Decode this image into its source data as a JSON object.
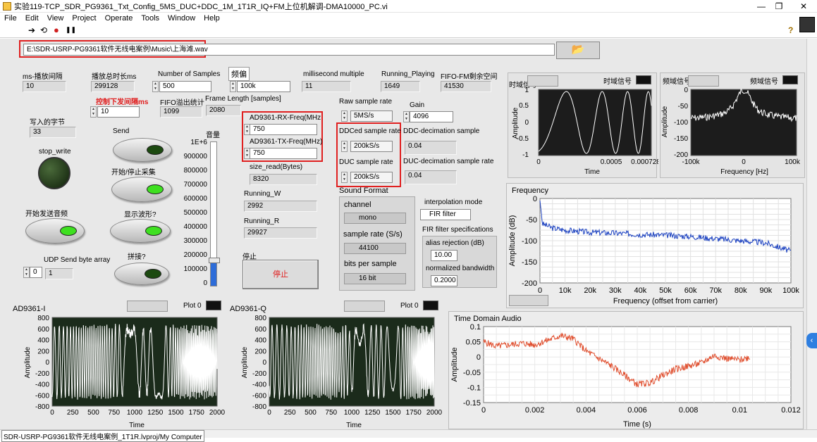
{
  "window": {
    "title": "实验119-TCP_SDR_PG9361_Txt_Config_5MS_DUC+DDC_1M_1T1R_IQ+FM上位机解调-DMA10000_PC.vi"
  },
  "menu": [
    "File",
    "Edit",
    "View",
    "Project",
    "Operate",
    "Tools",
    "Window",
    "Help"
  ],
  "toolbar": {
    "run": "➔",
    "run_cont": "⟲",
    "abort": "●",
    "pause": "❚❚",
    "help": "?"
  },
  "file_path": {
    "value": "E:\\SDR-USRP-PG9361软件无线电案例\\Music\\上海滩.wav"
  },
  "controls": {
    "ms_interval": {
      "label": "ms-播放间隔",
      "value": "10"
    },
    "play_total": {
      "label": "播放总时长ms",
      "value": "299128"
    },
    "num_samples": {
      "label": "Number of Samples",
      "value": "500"
    },
    "freq_offset": {
      "label": "频偏",
      "value": "100k"
    },
    "ms_multiple": {
      "label": "millisecond multiple",
      "value": "11"
    },
    "running_playing": {
      "label": "Running_Playing",
      "value": "1649"
    },
    "fifo_fm": {
      "label": "FIFO-FM剩余空间",
      "value": "41530"
    },
    "ctrl_interval": {
      "label": "控制下发间隔ms",
      "value": "10"
    },
    "fifo_overflow": {
      "label": "FIFO溢出统计",
      "value": "1099"
    },
    "frame_length": {
      "label": "Frame Length [samples]",
      "value": "2080"
    },
    "bytes_written": {
      "label": "写入的字节",
      "value": "33"
    },
    "send": {
      "label": "Send"
    },
    "stop_write": {
      "label": "stop_write"
    },
    "start_stop": {
      "label": "开始/停止采集"
    },
    "start_audio": {
      "label": "开始发送音频"
    },
    "show_wave": {
      "label": "显示波形?"
    },
    "splice": {
      "label": "拼接?"
    },
    "udp_send": {
      "label": "UDP Send byte array",
      "index": "0",
      "value": "1"
    },
    "volume": {
      "label": "音量",
      "ticks": [
        "1E+6",
        "900000",
        "800000",
        "700000",
        "600000",
        "500000",
        "400000",
        "300000",
        "200000",
        "100000",
        "0"
      ],
      "level": 0.18
    },
    "rx_freq": {
      "label": "AD9361-RX-Freq(MHz",
      "value": "750"
    },
    "tx_freq": {
      "label": "AD9361-TX-Freq(MHz)",
      "value": "750"
    },
    "size_read": {
      "label": "size_read(Bytes)",
      "value": "8320"
    },
    "running_w": {
      "label": "Running_W",
      "value": "2992"
    },
    "running_r": {
      "label": "Running_R",
      "value": "29927"
    },
    "stop": {
      "label": "停止",
      "button": "停止"
    },
    "raw_rate": {
      "label": "Raw sample rate",
      "value": "5MS/s"
    },
    "gain": {
      "label": "Gain",
      "value": "4096"
    },
    "ddced_rate": {
      "label": "DDCed sample rate",
      "value": "200kS/s"
    },
    "ddc_dec": {
      "label": "DDC-decimation sample",
      "value": "0.04"
    },
    "duc_rate": {
      "label": "DUC sample rate",
      "value": "200kS/s"
    },
    "duc_dec": {
      "label": "DUC-decimation sample rate",
      "value": "0.04"
    },
    "sound_format": {
      "label": "Sound Format",
      "channel_label": "channel",
      "channel": "mono",
      "rate_label": "sample rate (S/s)",
      "rate": "44100",
      "bits_label": "bits per sample",
      "bits": "16 bit"
    },
    "interp": {
      "label": "interpolation mode",
      "value": "FIR filter"
    },
    "fir": {
      "label": "FIR filter specifications",
      "alias_label": "alias rejection (dB)",
      "alias": "10.00",
      "bw_label": "normalized bandwidth",
      "bw": "0.2000"
    }
  },
  "graphs": {
    "time_small": {
      "tab1": "时域信号",
      "tab2": "时域信号",
      "ylabel": "Amplitude",
      "xlabel": "Time",
      "yticks": [
        "1",
        "0.5",
        "0",
        "-0.5",
        "-1"
      ],
      "xticks": [
        "0",
        "0.0005",
        "0.000728"
      ]
    },
    "freq_small": {
      "tab1": "频域信号",
      "tab2": "频域信号",
      "ylabel": "Amplitude",
      "xlabel": "Frequency [Hz]",
      "yticks": [
        "0",
        "-50",
        "-100",
        "-150",
        "-200"
      ],
      "xticks": [
        "-100k",
        "0",
        "100k"
      ]
    },
    "frequency": {
      "title": "Frequency",
      "ylabel": "Amplitude (dB)",
      "xlabel": "Frequency (offset from carrier)",
      "yticks": [
        "0",
        "-50",
        "-100",
        "-150",
        "-200"
      ],
      "xticks": [
        "0",
        "10k",
        "20k",
        "30k",
        "40k",
        "50k",
        "60k",
        "70k",
        "80k",
        "90k",
        "100k"
      ]
    },
    "iq_i": {
      "title": "AD9361-I",
      "plot": "Plot 0",
      "ylabel": "Amplitude",
      "xlabel": "Time",
      "yticks": [
        "800",
        "600",
        "400",
        "200",
        "0",
        "-200",
        "-400",
        "-600",
        "-800"
      ],
      "xticks": [
        "0",
        "250",
        "500",
        "750",
        "1000",
        "1250",
        "1500",
        "1750",
        "2000"
      ]
    },
    "iq_q": {
      "title": "AD9361-Q",
      "plot": "Plot 0",
      "ylabel": "Amplitude",
      "xlabel": "Time",
      "yticks": [
        "800",
        "600",
        "400",
        "200",
        "0",
        "-200",
        "-400",
        "-600",
        "-800"
      ],
      "xticks": [
        "0",
        "250",
        "500",
        "750",
        "1000",
        "1250",
        "1500",
        "1750",
        "2000"
      ]
    },
    "audio": {
      "title": "Time Domain Audio",
      "ylabel": "Amplitude",
      "xlabel": "Time (s)",
      "yticks": [
        "0.1",
        "0.05",
        "0",
        "-0.05",
        "-0.1",
        "-0.15"
      ],
      "xticks": [
        "0",
        "0.002",
        "0.004",
        "0.006",
        "0.008",
        "0.01",
        "0.012"
      ]
    }
  },
  "chart_data": [
    {
      "type": "line",
      "title": "Time Domain Audio",
      "xlabel": "Time (s)",
      "ylabel": "Amplitude",
      "xlim": [
        0,
        0.012
      ],
      "ylim": [
        -0.15,
        0.1
      ],
      "x": [
        0,
        0.0005,
        0.001,
        0.0015,
        0.002,
        0.0025,
        0.003,
        0.0035,
        0.004,
        0.0045,
        0.005,
        0.0055,
        0.006,
        0.0065,
        0.007,
        0.0075,
        0.008,
        0.0085,
        0.009,
        0.0095,
        0.01,
        0.0104
      ],
      "values": [
        0.05,
        0.035,
        0.04,
        0.045,
        0.04,
        0.055,
        0.07,
        0.06,
        0.02,
        -0.005,
        -0.03,
        -0.06,
        -0.09,
        -0.085,
        -0.06,
        -0.04,
        -0.03,
        -0.02,
        0.005,
        -0.005,
        -0.01,
        0.0
      ]
    },
    {
      "type": "line",
      "title": "Frequency",
      "xlabel": "Frequency (offset from carrier)",
      "ylabel": "Amplitude (dB)",
      "xlim": [
        0,
        100000
      ],
      "ylim": [
        -200,
        0
      ],
      "x": [
        0,
        1000,
        5000,
        10000,
        20000,
        30000,
        40000,
        50000,
        60000,
        70000,
        80000,
        90000,
        100000
      ],
      "values": [
        -5,
        -60,
        -70,
        -75,
        -80,
        -82,
        -85,
        -87,
        -90,
        -95,
        -100,
        -105,
        -125
      ]
    }
  ]
}
